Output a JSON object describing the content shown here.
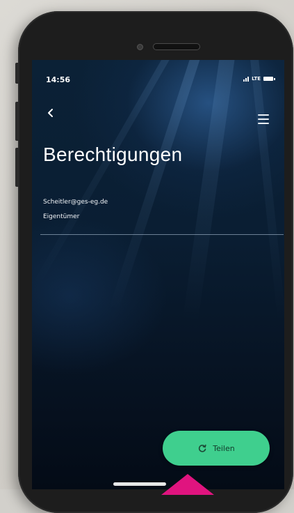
{
  "status_bar": {
    "time": "14:56",
    "network": "LTE"
  },
  "header": {
    "back_icon": "chevron-left-icon",
    "menu_icon": "hamburger-menu-icon"
  },
  "page": {
    "title": "Berechtigungen",
    "email": "Scheitler@ges-eg.de",
    "role": "Eigentümer"
  },
  "actions": {
    "share_label": "Teilen",
    "share_icon": "share-refresh-icon",
    "accent_color": "#3fcf8e"
  },
  "annotation": {
    "pointer_color": "#e0147f"
  }
}
